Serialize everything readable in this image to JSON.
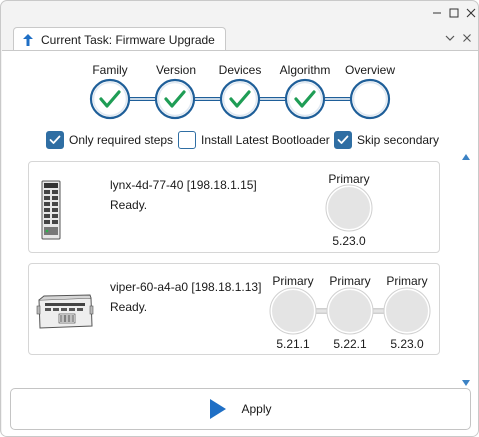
{
  "window": {
    "controls": [
      "minimize",
      "maximize",
      "close"
    ]
  },
  "tab": {
    "title": "Current Task: Firmware Upgrade",
    "icon": "upload-arrow-icon"
  },
  "wizard": {
    "steps": [
      {
        "label": "Family",
        "done": true
      },
      {
        "label": "Version",
        "done": true
      },
      {
        "label": "Devices",
        "done": true
      },
      {
        "label": "Algorithm",
        "done": true
      },
      {
        "label": "Overview",
        "done": false
      }
    ]
  },
  "options": [
    {
      "label": "Only required steps",
      "checked": true
    },
    {
      "label": "Install Latest Bootloader",
      "checked": false
    },
    {
      "label": "Skip secondary",
      "checked": true
    }
  ],
  "devices": [
    {
      "name": "lynx-4d-77-40 [198.18.1.15]",
      "status": "Ready.",
      "firmware": [
        {
          "role": "Primary",
          "version": "5.23.0"
        }
      ]
    },
    {
      "name": "viper-60-a4-a0 [198.18.1.13]",
      "status": "Ready.",
      "firmware": [
        {
          "role": "Primary",
          "version": "5.21.1"
        },
        {
          "role": "Primary",
          "version": "5.22.1"
        },
        {
          "role": "Primary",
          "version": "5.23.0"
        }
      ]
    }
  ],
  "actions": {
    "apply_label": "Apply"
  },
  "colors": {
    "accent": "#2f6ea3",
    "check_green": "#1f9d55",
    "step_ring": "#1f5f99",
    "bubble": "#e4e4e4"
  }
}
